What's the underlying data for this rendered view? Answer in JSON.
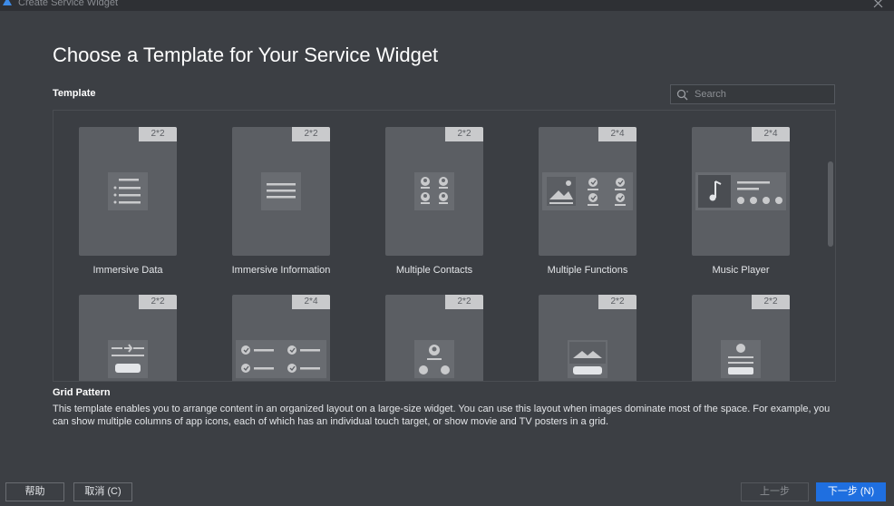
{
  "window": {
    "title": "Create Service Widget"
  },
  "page": {
    "heading": "Choose a Template for Your Service Widget",
    "section_label": "Template",
    "search": {
      "placeholder": "Search"
    }
  },
  "templates": [
    {
      "name": "Immersive Data",
      "size": "2*2",
      "icon": "list-icon"
    },
    {
      "name": "Immersive Information",
      "size": "2*2",
      "icon": "text-lines-icon"
    },
    {
      "name": "Multiple Contacts",
      "size": "2*2",
      "icon": "contacts-grid-icon"
    },
    {
      "name": "Multiple Functions",
      "size": "2*4",
      "icon": "functions-icon"
    },
    {
      "name": "Music Player",
      "size": "2*4",
      "icon": "music-note-icon"
    },
    {
      "name": "",
      "size": "2*2",
      "icon": "flight-icon"
    },
    {
      "name": "",
      "size": "2*4",
      "icon": "checklist-icon"
    },
    {
      "name": "",
      "size": "2*2",
      "icon": "contact-call-icon"
    },
    {
      "name": "",
      "size": "2*2",
      "icon": "image-icon"
    },
    {
      "name": "",
      "size": "2*2",
      "icon": "image-text-icon"
    }
  ],
  "selected_description": {
    "title": "Grid Pattern",
    "text": "This template enables you to arrange content in an organized layout on a large-size widget. You can use this layout when images dominate most of the space. For example, you can show multiple columns of app icons, each of which has an individual touch target, or show movie and TV posters in a grid."
  },
  "footer": {
    "help": "帮助",
    "cancel": "取消 (C)",
    "previous": "上一步",
    "next": "下一步 (N)"
  }
}
